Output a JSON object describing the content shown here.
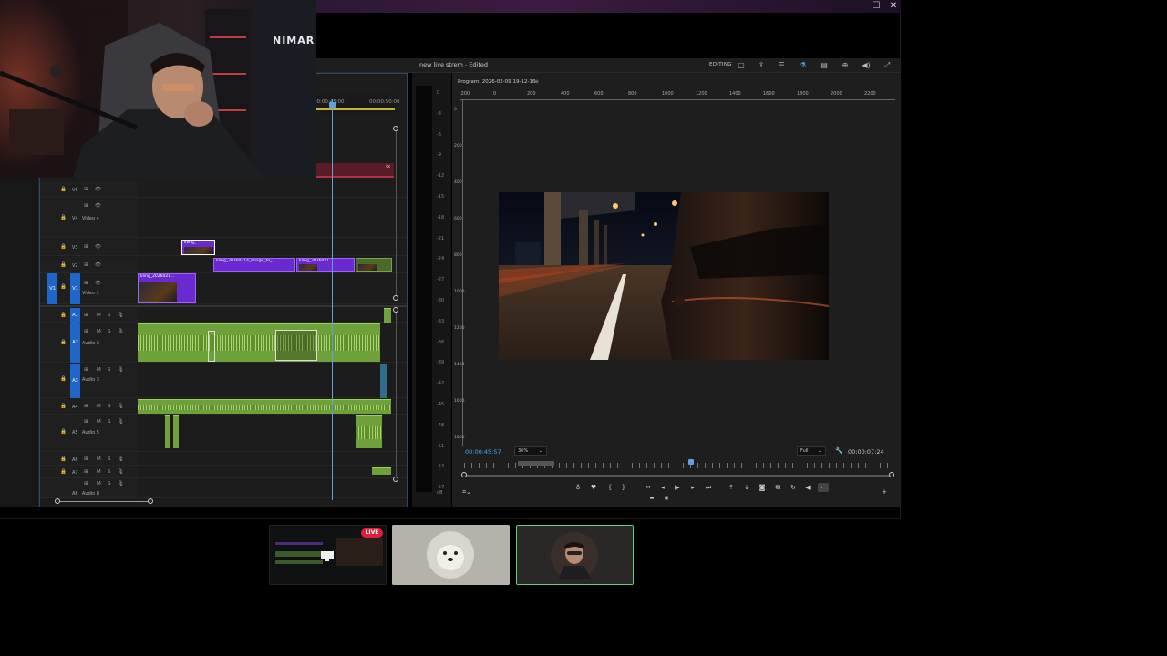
{
  "window": {
    "title": "new live strem - Edited",
    "workspace": "EDITING",
    "controls": {
      "minimize": "─",
      "maximize": "☐",
      "close": "✕"
    }
  },
  "header_icons": [
    "export-icon",
    "share-icon",
    "menu-icon",
    "flask-icon",
    "chat-icon",
    "zoom-icon",
    "volume-icon",
    "expand-icon"
  ],
  "webcam": {
    "wall_sign": "NIMAR"
  },
  "timeline": {
    "ruler_marks": [
      "00:00:45:00",
      "00:00:50:00"
    ],
    "tracks_video": [
      {
        "id": "V6",
        "name": ""
      },
      {
        "id": "V4",
        "name": "Video 4"
      },
      {
        "id": "V3",
        "name": ""
      },
      {
        "id": "V2",
        "name": ""
      },
      {
        "id": "V1",
        "name": "Video 1",
        "source": "V1"
      }
    ],
    "tracks_audio": [
      {
        "id": "A1",
        "name": ""
      },
      {
        "id": "A2",
        "name": "Audio 2"
      },
      {
        "id": "A3",
        "name": "Audio 3"
      },
      {
        "id": "A4",
        "name": ""
      },
      {
        "id": "A5",
        "name": "Audio 5"
      },
      {
        "id": "A6",
        "name": ""
      },
      {
        "id": "A7",
        "name": ""
      },
      {
        "id": "A8",
        "name": "Audio 8"
      }
    ],
    "clips": {
      "v3": "kling_",
      "v2a": "kling_20260214_Image_to_...",
      "v2b": "kling_2026021...",
      "v1": "kling_2026021..."
    },
    "fx": "fx",
    "toggle_glyphs": {
      "lock": "🔒",
      "sync": "⊞",
      "eye": "👁",
      "mute": "M",
      "solo": "S",
      "mic": "🎙"
    }
  },
  "meter": {
    "db_scale": [
      "0",
      "-3",
      "-6",
      "-9",
      "-12",
      "-15",
      "-18",
      "-21",
      "-24",
      "-27",
      "-30",
      "-33",
      "-36",
      "-39",
      "-42",
      "-45",
      "-48",
      "-51",
      "-54",
      "-57",
      "dB"
    ]
  },
  "program_monitor": {
    "title": "Program: 2026-02-09 19-12-16",
    "ruler": [
      "|200",
      "0",
      "200",
      "400",
      "600",
      "800",
      "1000",
      "1200",
      "1400",
      "1600",
      "1800",
      "2000",
      "2200"
    ],
    "vruler": [
      "0",
      "200",
      "400",
      "600",
      "800",
      "1000",
      "1200",
      "1400",
      "1600",
      "1800"
    ],
    "timecode_current": "00:00:45:57",
    "zoom": "36%",
    "quality": "Full",
    "timecode_duration": "00:00:07:24",
    "transport": [
      "⏮",
      "◂",
      "▶",
      "▸",
      "⏭"
    ]
  },
  "scenes": {
    "live_label": "LIVE"
  },
  "colors": {
    "accent": "#1e66c8",
    "video_clip": "#6b2ad1",
    "audio_clip": "#6fa13a",
    "playhead": "#5fa0e0",
    "timecode": "#4ea3ff",
    "live": "#e0203a",
    "selected_scene": "#5fd07a"
  }
}
